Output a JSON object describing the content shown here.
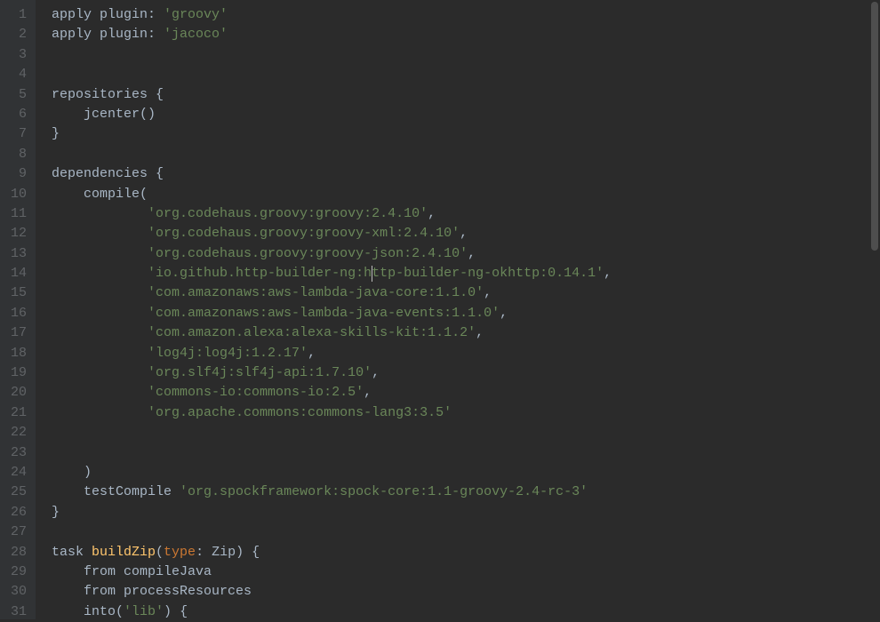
{
  "gutter": {
    "start": 1,
    "end": 31
  },
  "lines": [
    {
      "indent": 0,
      "tokens": [
        {
          "t": "apply plugin: ",
          "c": "id"
        },
        {
          "t": "'groovy'",
          "c": "str"
        }
      ]
    },
    {
      "indent": 0,
      "tokens": [
        {
          "t": "apply plugin: ",
          "c": "id"
        },
        {
          "t": "'jacoco'",
          "c": "str"
        }
      ]
    },
    {
      "indent": 0,
      "tokens": []
    },
    {
      "indent": 0,
      "tokens": []
    },
    {
      "indent": 0,
      "tokens": [
        {
          "t": "repositories ",
          "c": "id"
        },
        {
          "t": "{",
          "c": "punc"
        }
      ]
    },
    {
      "indent": 1,
      "tokens": [
        {
          "t": "jcenter()",
          "c": "id"
        }
      ]
    },
    {
      "indent": 0,
      "tokens": [
        {
          "t": "}",
          "c": "punc"
        }
      ]
    },
    {
      "indent": 0,
      "tokens": []
    },
    {
      "indent": 0,
      "tokens": [
        {
          "t": "dependencies ",
          "c": "id"
        },
        {
          "t": "{",
          "c": "punc"
        }
      ]
    },
    {
      "indent": 1,
      "tokens": [
        {
          "t": "compile(",
          "c": "id"
        }
      ]
    },
    {
      "indent": 3,
      "tokens": [
        {
          "t": "'org.codehaus.groovy:groovy:2.4.10'",
          "c": "str"
        },
        {
          "t": ",",
          "c": "punc"
        }
      ]
    },
    {
      "indent": 3,
      "tokens": [
        {
          "t": "'org.codehaus.groovy:groovy-xml:2.4.10'",
          "c": "str"
        },
        {
          "t": ",",
          "c": "punc"
        }
      ]
    },
    {
      "indent": 3,
      "tokens": [
        {
          "t": "'org.codehaus.groovy:groovy-json:2.4.10'",
          "c": "str"
        },
        {
          "t": ",",
          "c": "punc"
        }
      ]
    },
    {
      "indent": 3,
      "tokens": [
        {
          "t": "'io.github.http-builder-ng:h",
          "c": "str"
        },
        {
          "cursor": true
        },
        {
          "t": "ttp-builder-ng-okhttp:0.14.1'",
          "c": "str"
        },
        {
          "t": ",",
          "c": "punc"
        }
      ]
    },
    {
      "indent": 3,
      "tokens": [
        {
          "t": "'com.amazonaws:aws-lambda-java-core:1.1.0'",
          "c": "str"
        },
        {
          "t": ",",
          "c": "punc"
        }
      ]
    },
    {
      "indent": 3,
      "tokens": [
        {
          "t": "'com.amazonaws:aws-lambda-java-events:1.1.0'",
          "c": "str"
        },
        {
          "t": ",",
          "c": "punc"
        }
      ]
    },
    {
      "indent": 3,
      "tokens": [
        {
          "t": "'com.amazon.alexa:alexa-skills-kit:1.1.2'",
          "c": "str"
        },
        {
          "t": ",",
          "c": "punc"
        }
      ]
    },
    {
      "indent": 3,
      "tokens": [
        {
          "t": "'log4j:log4j:1.2.17'",
          "c": "str"
        },
        {
          "t": ",",
          "c": "punc"
        }
      ]
    },
    {
      "indent": 3,
      "tokens": [
        {
          "t": "'org.slf4j:slf4j-api:1.7.10'",
          "c": "str"
        },
        {
          "t": ",",
          "c": "punc"
        }
      ]
    },
    {
      "indent": 3,
      "tokens": [
        {
          "t": "'commons-io:commons-io:2.5'",
          "c": "str"
        },
        {
          "t": ",",
          "c": "punc"
        }
      ]
    },
    {
      "indent": 3,
      "tokens": [
        {
          "t": "'org.apache.commons:commons-lang3:3.5'",
          "c": "str"
        }
      ]
    },
    {
      "indent": 0,
      "tokens": []
    },
    {
      "indent": 0,
      "tokens": []
    },
    {
      "indent": 1,
      "tokens": [
        {
          "t": ")",
          "c": "punc"
        }
      ]
    },
    {
      "indent": 1,
      "tokens": [
        {
          "t": "testCompile ",
          "c": "id"
        },
        {
          "t": "'org.spockframework:spock-core:1.1-groovy-2.4-rc-3'",
          "c": "str"
        }
      ]
    },
    {
      "indent": 0,
      "tokens": [
        {
          "t": "}",
          "c": "punc"
        }
      ]
    },
    {
      "indent": 0,
      "tokens": []
    },
    {
      "indent": 0,
      "tokens": [
        {
          "t": "task ",
          "c": "id"
        },
        {
          "t": "buildZip",
          "c": "fn"
        },
        {
          "t": "(",
          "c": "punc"
        },
        {
          "t": "type",
          "c": "kw"
        },
        {
          "t": ": Zip) ",
          "c": "id"
        },
        {
          "t": "{",
          "c": "punc"
        }
      ]
    },
    {
      "indent": 1,
      "tokens": [
        {
          "t": "from compileJava",
          "c": "id"
        }
      ]
    },
    {
      "indent": 1,
      "tokens": [
        {
          "t": "from processResources",
          "c": "id"
        }
      ]
    },
    {
      "indent": 1,
      "tokens": [
        {
          "t": "into(",
          "c": "id"
        },
        {
          "t": "'lib'",
          "c": "str"
        },
        {
          "t": ") ",
          "c": "id"
        },
        {
          "t": "{",
          "c": "punc"
        }
      ]
    }
  ]
}
